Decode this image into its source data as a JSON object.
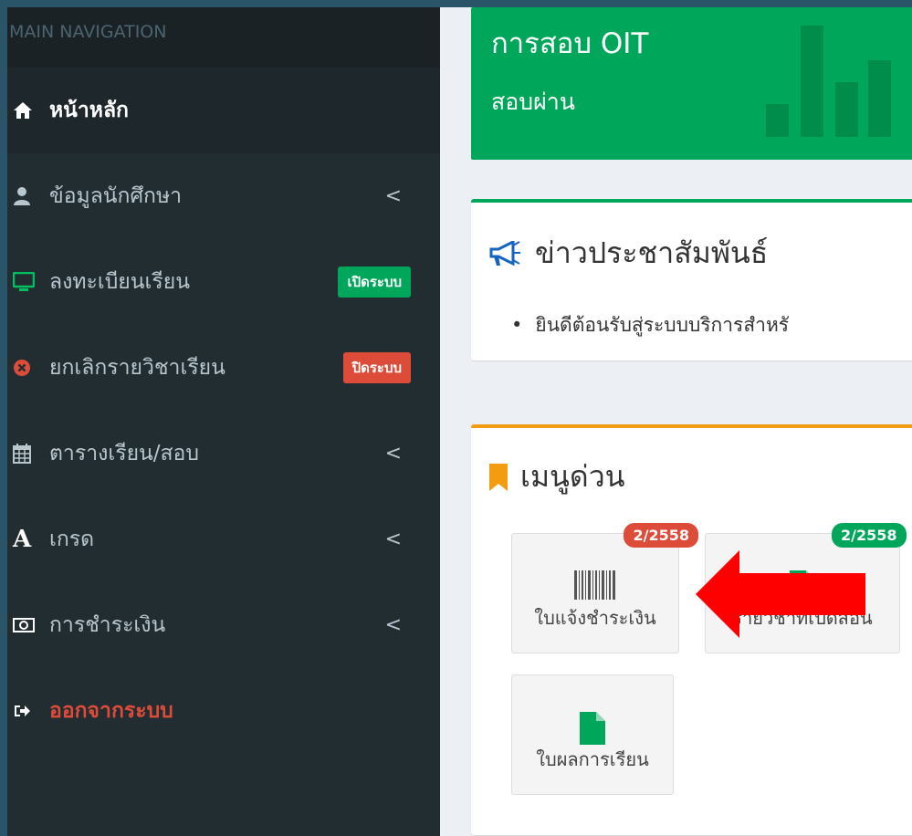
{
  "sidebar": {
    "header": "MAIN NAVIGATION",
    "items": [
      {
        "label": "หน้าหลัก",
        "icon": "home-icon"
      },
      {
        "label": "ข้อมูลนักศึกษา",
        "icon": "user-icon",
        "chevron": "<"
      },
      {
        "label": "ลงทะเบียนเรียน",
        "icon": "monitor-icon",
        "badge": "เปิดระบบ"
      },
      {
        "label": "ยกเลิกรายวิชาเรียน",
        "icon": "close-circle-icon",
        "badge": "ปิดระบบ"
      },
      {
        "label": "ตารางเรียน/สอบ",
        "icon": "calendar-icon",
        "chevron": "<"
      },
      {
        "label": "เกรด",
        "icon": "font-a-icon",
        "chevron": "<"
      },
      {
        "label": "การชำระเงิน",
        "icon": "money-icon",
        "chevron": "<"
      },
      {
        "label": "ออกจากระบบ",
        "icon": "sign-out-icon"
      }
    ]
  },
  "info_box": {
    "title": "การสอบ OIT",
    "subtitle": "สอบผ่าน",
    "icon": "bar-chart-icon"
  },
  "news": {
    "title": "ข่าวประชาสัมพันธ์",
    "icon": "bullhorn-icon",
    "items": [
      "ยินดีต้อนรับสู่ระบบบริการสำหรั"
    ]
  },
  "quick_menu": {
    "title": "เมนูด่วน",
    "icon": "bookmark-icon",
    "buttons": [
      {
        "label": "ใบแจ้งชำระเงิน",
        "badge": "2/2558",
        "icon": "barcode-icon"
      },
      {
        "label": "รายวิชาที่เปิดสอน",
        "badge": "2/2558",
        "icon": "file-icon"
      },
      {
        "label": "ใบผลการเรียน",
        "icon": "file-icon"
      }
    ]
  },
  "colors": {
    "green": "#00a65a",
    "red": "#dd4b39",
    "orange": "#f39c12",
    "sidebar_bg": "#222d32",
    "arrow": "#ff0000"
  }
}
